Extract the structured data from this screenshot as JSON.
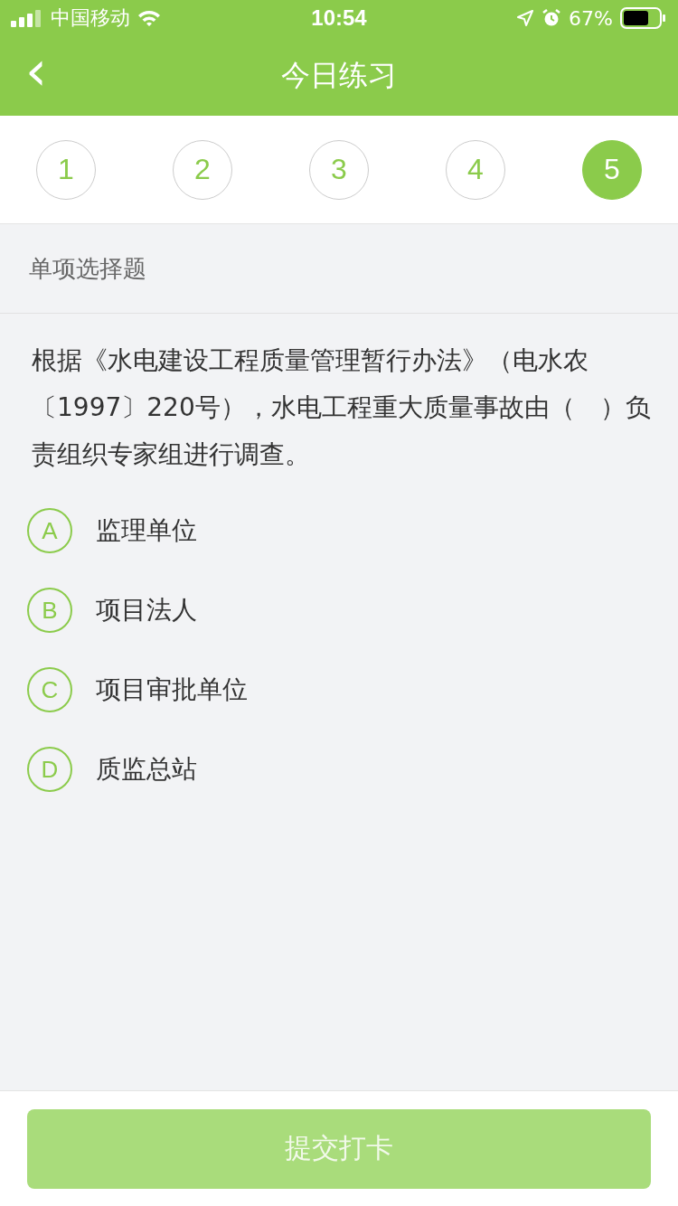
{
  "status_bar": {
    "carrier": "中国移动",
    "time": "10:54",
    "battery": "67%"
  },
  "nav": {
    "back": "‹",
    "title": "今日练习"
  },
  "steps": [
    {
      "label": "1",
      "selected": false
    },
    {
      "label": "2",
      "selected": false
    },
    {
      "label": "3",
      "selected": false
    },
    {
      "label": "4",
      "selected": false
    },
    {
      "label": "5",
      "selected": true
    }
  ],
  "question": {
    "type_label": "单项选择题",
    "text": "根据《水电建设工程质量管理暂行办法》（电水农〔1997〕220号），水电工程重大质量事故由（　）负责组织专家组进行调查。",
    "options": [
      {
        "letter": "A",
        "text": "监理单位",
        "selected": false
      },
      {
        "letter": "B",
        "text": "项目法人",
        "selected": false
      },
      {
        "letter": "C",
        "text": "项目审批单位",
        "selected": false
      },
      {
        "letter": "D",
        "text": "质监总站",
        "selected": false
      }
    ]
  },
  "submit": {
    "label": "提交打卡",
    "disabled": true
  }
}
